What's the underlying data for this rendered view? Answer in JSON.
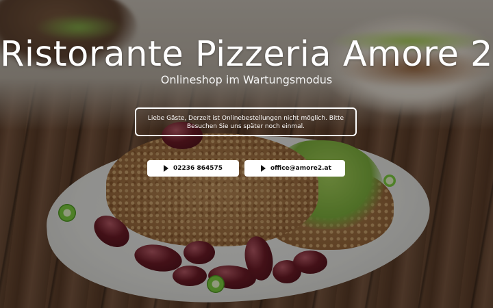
{
  "header": {
    "title": "Ristorante Pizzeria Amore 2",
    "subtitle": "Onlineshop im Wartungsmodus"
  },
  "notice": {
    "text": "Liebe Gäste, Derzeit ist Onlinebestellungen nicht möglich. Bitte Besuchen Sie uns später noch einmal."
  },
  "contacts": {
    "phone_label": "02236 864575",
    "email_label": "office@amore2.at",
    "icon": "play-icon"
  }
}
